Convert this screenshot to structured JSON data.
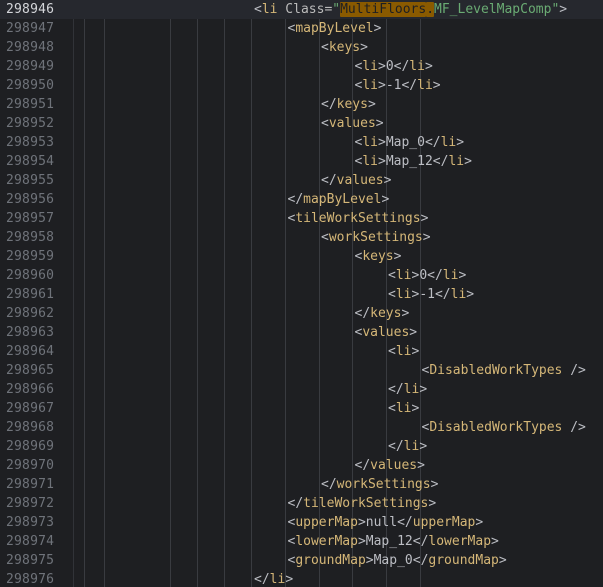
{
  "editor": {
    "lines": [
      {
        "num": "298946",
        "indent": 0,
        "parts": [
          [
            "<",
            "p"
          ],
          [
            "li",
            "t"
          ],
          [
            " Class=",
            "a"
          ],
          [
            "\"",
            "s"
          ],
          [
            "MultiFloors",
            "h"
          ],
          [
            ".",
            "h"
          ],
          [
            "MF_LevelMapComp",
            "s"
          ],
          [
            "\"",
            "s"
          ],
          [
            ">",
            "p"
          ]
        ],
        "current": true
      },
      {
        "num": "298947",
        "indent": 1,
        "parts": [
          [
            "<",
            "p"
          ],
          [
            "mapByLevel",
            "t"
          ],
          [
            ">",
            "p"
          ]
        ]
      },
      {
        "num": "298948",
        "indent": 2,
        "parts": [
          [
            "<",
            "p"
          ],
          [
            "keys",
            "t"
          ],
          [
            ">",
            "p"
          ]
        ]
      },
      {
        "num": "298949",
        "indent": 3,
        "parts": [
          [
            "<",
            "p"
          ],
          [
            "li",
            "t"
          ],
          [
            ">",
            "p"
          ],
          [
            "0",
            "x"
          ],
          [
            "</",
            "p"
          ],
          [
            "li",
            "t"
          ],
          [
            ">",
            "p"
          ]
        ]
      },
      {
        "num": "298950",
        "indent": 3,
        "parts": [
          [
            "<",
            "p"
          ],
          [
            "li",
            "t"
          ],
          [
            ">",
            "p"
          ],
          [
            "-1",
            "x"
          ],
          [
            "</",
            "p"
          ],
          [
            "li",
            "t"
          ],
          [
            ">",
            "p"
          ]
        ]
      },
      {
        "num": "298951",
        "indent": 2,
        "parts": [
          [
            "</",
            "p"
          ],
          [
            "keys",
            "t"
          ],
          [
            ">",
            "p"
          ]
        ]
      },
      {
        "num": "298952",
        "indent": 2,
        "parts": [
          [
            "<",
            "p"
          ],
          [
            "values",
            "t"
          ],
          [
            ">",
            "p"
          ]
        ]
      },
      {
        "num": "298953",
        "indent": 3,
        "parts": [
          [
            "<",
            "p"
          ],
          [
            "li",
            "t"
          ],
          [
            ">",
            "p"
          ],
          [
            "Map_0",
            "x"
          ],
          [
            "</",
            "p"
          ],
          [
            "li",
            "t"
          ],
          [
            ">",
            "p"
          ]
        ]
      },
      {
        "num": "298954",
        "indent": 3,
        "parts": [
          [
            "<",
            "p"
          ],
          [
            "li",
            "t"
          ],
          [
            ">",
            "p"
          ],
          [
            "Map_12",
            "x"
          ],
          [
            "</",
            "p"
          ],
          [
            "li",
            "t"
          ],
          [
            ">",
            "p"
          ]
        ]
      },
      {
        "num": "298955",
        "indent": 2,
        "parts": [
          [
            "</",
            "p"
          ],
          [
            "values",
            "t"
          ],
          [
            ">",
            "p"
          ]
        ]
      },
      {
        "num": "298956",
        "indent": 1,
        "parts": [
          [
            "</",
            "p"
          ],
          [
            "mapByLevel",
            "t"
          ],
          [
            ">",
            "p"
          ]
        ]
      },
      {
        "num": "298957",
        "indent": 1,
        "parts": [
          [
            "<",
            "p"
          ],
          [
            "tileWorkSettings",
            "t"
          ],
          [
            ">",
            "p"
          ]
        ]
      },
      {
        "num": "298958",
        "indent": 2,
        "parts": [
          [
            "<",
            "p"
          ],
          [
            "workSettings",
            "t"
          ],
          [
            ">",
            "p"
          ]
        ]
      },
      {
        "num": "298959",
        "indent": 3,
        "parts": [
          [
            "<",
            "p"
          ],
          [
            "keys",
            "t"
          ],
          [
            ">",
            "p"
          ]
        ]
      },
      {
        "num": "298960",
        "indent": 4,
        "parts": [
          [
            "<",
            "p"
          ],
          [
            "li",
            "t"
          ],
          [
            ">",
            "p"
          ],
          [
            "0",
            "x"
          ],
          [
            "</",
            "p"
          ],
          [
            "li",
            "t"
          ],
          [
            ">",
            "p"
          ]
        ]
      },
      {
        "num": "298961",
        "indent": 4,
        "parts": [
          [
            "<",
            "p"
          ],
          [
            "li",
            "t"
          ],
          [
            ">",
            "p"
          ],
          [
            "-1",
            "x"
          ],
          [
            "</",
            "p"
          ],
          [
            "li",
            "t"
          ],
          [
            ">",
            "p"
          ]
        ]
      },
      {
        "num": "298962",
        "indent": 3,
        "parts": [
          [
            "</",
            "p"
          ],
          [
            "keys",
            "t"
          ],
          [
            ">",
            "p"
          ]
        ]
      },
      {
        "num": "298963",
        "indent": 3,
        "parts": [
          [
            "<",
            "p"
          ],
          [
            "values",
            "t"
          ],
          [
            ">",
            "p"
          ]
        ]
      },
      {
        "num": "298964",
        "indent": 4,
        "parts": [
          [
            "<",
            "p"
          ],
          [
            "li",
            "t"
          ],
          [
            ">",
            "p"
          ]
        ]
      },
      {
        "num": "298965",
        "indent": 5,
        "parts": [
          [
            "<",
            "p"
          ],
          [
            "DisabledWorkTypes",
            "t"
          ],
          [
            " />",
            "p"
          ]
        ]
      },
      {
        "num": "298966",
        "indent": 4,
        "parts": [
          [
            "</",
            "p"
          ],
          [
            "li",
            "t"
          ],
          [
            ">",
            "p"
          ]
        ]
      },
      {
        "num": "298967",
        "indent": 4,
        "parts": [
          [
            "<",
            "p"
          ],
          [
            "li",
            "t"
          ],
          [
            ">",
            "p"
          ]
        ]
      },
      {
        "num": "298968",
        "indent": 5,
        "parts": [
          [
            "<",
            "p"
          ],
          [
            "DisabledWorkTypes",
            "t"
          ],
          [
            " />",
            "p"
          ]
        ]
      },
      {
        "num": "298969",
        "indent": 4,
        "parts": [
          [
            "</",
            "p"
          ],
          [
            "li",
            "t"
          ],
          [
            ">",
            "p"
          ]
        ]
      },
      {
        "num": "298970",
        "indent": 3,
        "parts": [
          [
            "</",
            "p"
          ],
          [
            "values",
            "t"
          ],
          [
            ">",
            "p"
          ]
        ]
      },
      {
        "num": "298971",
        "indent": 2,
        "parts": [
          [
            "</",
            "p"
          ],
          [
            "workSettings",
            "t"
          ],
          [
            ">",
            "p"
          ]
        ]
      },
      {
        "num": "298972",
        "indent": 1,
        "parts": [
          [
            "</",
            "p"
          ],
          [
            "tileWorkSettings",
            "t"
          ],
          [
            ">",
            "p"
          ]
        ]
      },
      {
        "num": "298973",
        "indent": 1,
        "parts": [
          [
            "<",
            "p"
          ],
          [
            "upperMap",
            "t"
          ],
          [
            ">",
            "p"
          ],
          [
            "null",
            "x"
          ],
          [
            "</",
            "p"
          ],
          [
            "upperMap",
            "t"
          ],
          [
            ">",
            "p"
          ]
        ]
      },
      {
        "num": "298974",
        "indent": 1,
        "parts": [
          [
            "<",
            "p"
          ],
          [
            "lowerMap",
            "t"
          ],
          [
            ">",
            "p"
          ],
          [
            "Map_12",
            "x"
          ],
          [
            "</",
            "p"
          ],
          [
            "lowerMap",
            "t"
          ],
          [
            ">",
            "p"
          ]
        ]
      },
      {
        "num": "298975",
        "indent": 1,
        "parts": [
          [
            "<",
            "p"
          ],
          [
            "groundMap",
            "t"
          ],
          [
            ">",
            "p"
          ],
          [
            "Map_0",
            "x"
          ],
          [
            "</",
            "p"
          ],
          [
            "groundMap",
            "t"
          ],
          [
            ">",
            "p"
          ]
        ]
      },
      {
        "num": "298976",
        "indent": 0,
        "parts": [
          [
            "</",
            "p"
          ],
          [
            "li",
            "t"
          ],
          [
            ">",
            "p"
          ]
        ]
      }
    ]
  },
  "colors": {
    "background": "#1e1f22",
    "tag": "#d5b778",
    "string": "#6aab73",
    "text": "#bcbec4",
    "line_number": "#6f737a",
    "find_highlight": "#8a5a00"
  }
}
